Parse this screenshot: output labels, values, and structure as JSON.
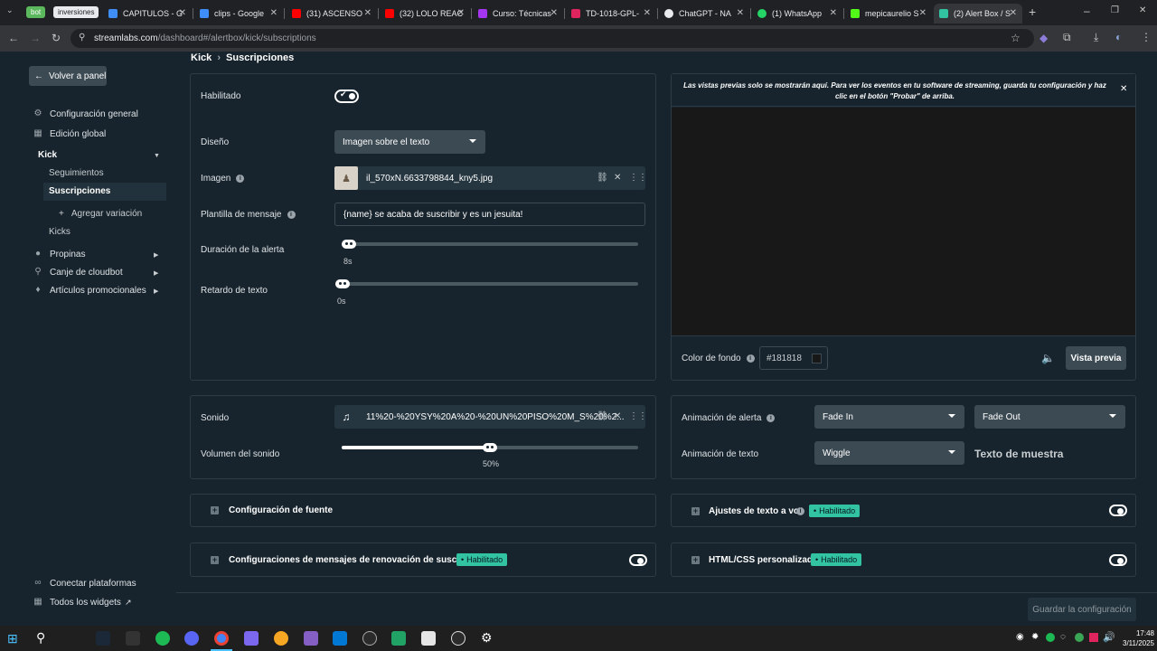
{
  "browser": {
    "pills": [
      "bot",
      "inversiones"
    ],
    "tabs": [
      {
        "label": "CAPITULOS - G",
        "color": "#3f8ef7"
      },
      {
        "label": "clips - Google",
        "color": "#3f8ef7"
      },
      {
        "label": "(31) ASCENSO",
        "color": "#ff0000"
      },
      {
        "label": "(32) LOLO REAC",
        "color": "#ff0000"
      },
      {
        "label": "Curso: Técnicas",
        "color": "#a435f0"
      },
      {
        "label": "TD-1018-GPL-",
        "color": "#e0245e"
      },
      {
        "label": "ChatGPT - NA",
        "color": "#e8eaed"
      },
      {
        "label": "(1) WhatsApp",
        "color": "#25d366"
      },
      {
        "label": "mepicaurelio S",
        "color": "#53fc18"
      },
      {
        "label": "(2) Alert Box / S",
        "color": "#31c3a2"
      }
    ],
    "url_host": "streamlabs.com",
    "url_path": "/dashboard#/alertbox/kick/subscriptions"
  },
  "header": {
    "platform": "Kick",
    "sep": "›",
    "page": "Suscripciones"
  },
  "sidebar": {
    "back": "Volver a panel",
    "general": "Configuración general",
    "global_edit": "Edición global",
    "platform": "Kick",
    "sub_follows": "Seguimientos",
    "sub_subs": "Suscripciones",
    "add_variation": "Agregar variación",
    "sub_kicks": "Kicks",
    "tips": "Propinas",
    "cloudbot": "Canje de cloudbot",
    "merch": "Artículos promocionales",
    "connect": "Conectar plataformas",
    "all_widgets": "Todos los widgets"
  },
  "form": {
    "enabled_label": "Habilitado",
    "layout_label": "Diseño",
    "layout_value": "Imagen sobre el texto",
    "image_label": "Imagen",
    "image_file": "il_570xN.6633798844_kny5.jpg",
    "template_label": "Plantilla de mensaje",
    "template_value": "{name} se acaba de suscribir y es un jesuita!",
    "duration_label": "Duración de la alerta",
    "duration_value": "8s",
    "duration_fraction": 0.02,
    "delay_label": "Retardo de texto",
    "delay_value": "0s",
    "delay_fraction": 0.0,
    "sound_label": "Sonido",
    "sound_file": "11%20-%20YSY%20A%20-%20UN%20PISO%20M_S%20%2...",
    "volume_label": "Volumen del sonido",
    "volume_value": "50%",
    "volume_fraction": 0.5
  },
  "preview": {
    "notice": "Las vistas previas solo se mostrarán aquí. Para ver los eventos en tu software de streaming, guarda tu configuración y haz clic en el botón \"Probar\" de arriba.",
    "bg_label": "Color de fondo",
    "bg_value": "#181818",
    "preview_button": "Vista previa"
  },
  "animation": {
    "alert_label": "Animación de alerta",
    "alert_in": "Fade In",
    "alert_out": "Fade Out",
    "text_label": "Animación de texto",
    "text_value": "Wiggle",
    "sample_text": "Texto de muestra"
  },
  "sections": {
    "font": "Configuración de fuente",
    "tts": "Ajustes de texto a voz",
    "resub": "Configuraciones de mensajes de renovación de suscripción",
    "custom": "HTML/CSS personalizado",
    "enabled_badge": "Habilitado"
  },
  "save_button": "Guardar la configuración",
  "taskbar": {
    "time": "17:48",
    "date": "3/11/2025"
  }
}
